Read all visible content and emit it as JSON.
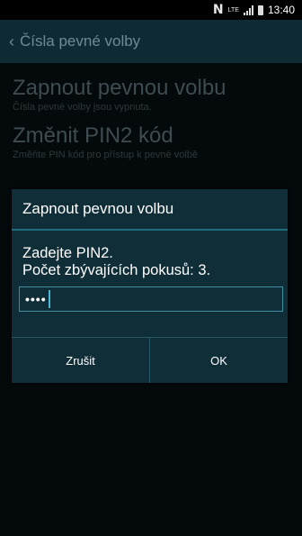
{
  "status_bar": {
    "time": "13:40",
    "nfc_icon": "N",
    "network": "LTE"
  },
  "action_bar": {
    "back_icon": "‹",
    "title": "Čísla pevné volby"
  },
  "settings": [
    {
      "title": "Zapnout pevnou volbu",
      "summary": "Čísla pevné volby jsou vypnuta."
    },
    {
      "title": "Změnit PIN2 kód",
      "summary": "Změňte PIN kód pro přístup k pevné volbě"
    }
  ],
  "dialog": {
    "title": "Zapnout pevnou volbu",
    "message_line1": "Zadejte PIN2.",
    "message_line2": "Počet zbývajících pokusů: 3.",
    "pin_value": "••••",
    "cancel_label": "Zrušit",
    "ok_label": "OK"
  }
}
